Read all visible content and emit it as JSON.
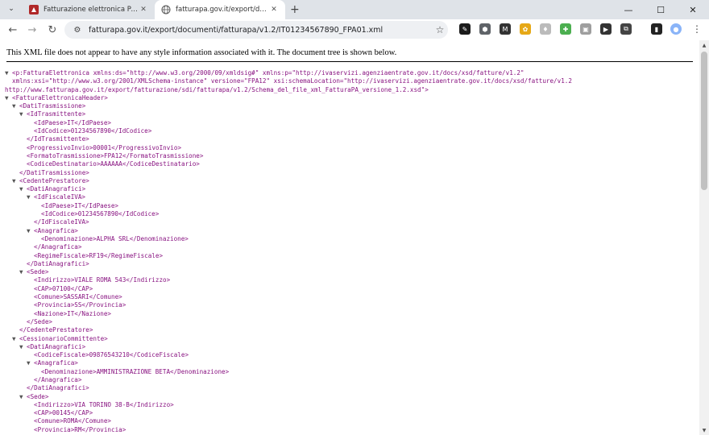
{
  "tabs": [
    {
      "title": "Fatturazione elettronica PA - Fa"
    },
    {
      "title": "fatturapa.gov.it/export/docume"
    }
  ],
  "toolbar": {
    "url": "fatturapa.gov.it/export/documenti/fatturapa/v1.2/IT01234567890_FPA01.xml"
  },
  "page": {
    "notice": "This XML file does not appear to have any style information associated with it. The document tree is shown below."
  },
  "xml": {
    "root_line1": "<p:FatturaElettronica xmlns:ds=\"http://www.w3.org/2000/09/xmldsig#\" xmlns:p=\"http://ivaservizi.agenziaentrate.gov.it/docs/xsd/fatture/v1.2\"",
    "root_line2": "xmlns:xsi=\"http://www.w3.org/2001/XMLSchema-instance\" versione=\"FPA12\" xsi:schemaLocation=\"http://ivaservizi.agenziaentrate.gov.it/docs/xsd/fatture/v1.2",
    "root_line3": "http://www.fatturapa.gov.it/export/fatturazione/sdi/fatturapa/v1.2/Schema_del_file_xml_FatturaPA_versione_1.2.xsd\">",
    "lines": [
      "<FatturaElettronicaHeader>",
      "<DatiTrasmissione>",
      "<IdTrasmittente>",
      "<IdPaese>IT</IdPaese>",
      "<IdCodice>01234567890</IdCodice>",
      "</IdTrasmittente>",
      "<ProgressivoInvio>00001</ProgressivoInvio>",
      "<FormatoTrasmissione>FPA12</FormatoTrasmissione>",
      "<CodiceDestinatario>AAAAAA</CodiceDestinatario>",
      "</DatiTrasmissione>",
      "<CedentePrestatore>",
      "<DatiAnagrafici>",
      "<IdFiscaleIVA>",
      "<IdPaese>IT</IdPaese>",
      "<IdCodice>01234567890</IdCodice>",
      "</IdFiscaleIVA>",
      "<Anagrafica>",
      "<Denominazione>ALPHA SRL</Denominazione>",
      "</Anagrafica>",
      "<RegimeFiscale>RF19</RegimeFiscale>",
      "</DatiAnagrafici>",
      "<Sede>",
      "<Indirizzo>VIALE ROMA 543</Indirizzo>",
      "<CAP>07100</CAP>",
      "<Comune>SASSARI</Comune>",
      "<Provincia>SS</Provincia>",
      "<Nazione>IT</Nazione>",
      "</Sede>",
      "</CedentePrestatore>",
      "<CessionarioCommittente>",
      "<DatiAnagrafici>",
      "<CodiceFiscale>09876543210</CodiceFiscale>",
      "<Anagrafica>",
      "<Denominazione>AMMINISTRAZIONE BETA</Denominazione>",
      "</Anagrafica>",
      "</DatiAnagrafici>",
      "<Sede>",
      "<Indirizzo>VIA TORINO 38-B</Indirizzo>",
      "<CAP>00145</CAP>",
      "<Comune>ROMA</Comune>",
      "<Provincia>RM</Provincia>"
    ]
  }
}
